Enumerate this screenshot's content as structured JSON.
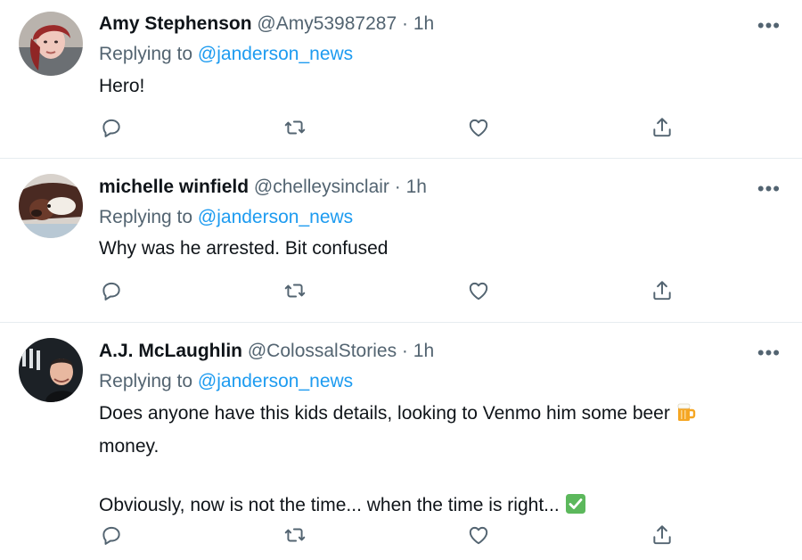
{
  "tweets": [
    {
      "name": "Amy Stephenson",
      "handle": "@Amy53987287",
      "separator": "·",
      "time": "1h",
      "replying_prefix": "Replying to ",
      "replying_to": "@janderson_news",
      "text": "Hero!",
      "more_label": "•••",
      "avatar": "avatar-amy"
    },
    {
      "name": "michelle winfield",
      "handle": "@chelleysinclair",
      "separator": "·",
      "time": "1h",
      "replying_prefix": "Replying to ",
      "replying_to": "@janderson_news",
      "text": "Why was he arrested. Bit confused",
      "more_label": "•••",
      "avatar": "avatar-dog"
    },
    {
      "name": "A.J. McLaughlin",
      "handle": "@ColossalStories",
      "separator": "·",
      "time": "1h",
      "replying_prefix": "Replying to ",
      "replying_to": "@janderson_news",
      "text_line1": "Does anyone have this kids details, looking to Venmo him some beer ",
      "text_line2": "money.",
      "text_line3": "Obviously, now is not the time... when the time is right... ",
      "more_label": "•••",
      "avatar": "avatar-aj",
      "emojis": [
        "beer-mug-icon",
        "check-mark-icon"
      ]
    }
  ],
  "actions": [
    "reply-icon",
    "retweet-icon",
    "like-icon",
    "share-icon"
  ],
  "colors": {
    "text": "#0f1419",
    "secondary": "#536471",
    "link": "#1d9bf0",
    "divider": "#e6ecf0"
  }
}
